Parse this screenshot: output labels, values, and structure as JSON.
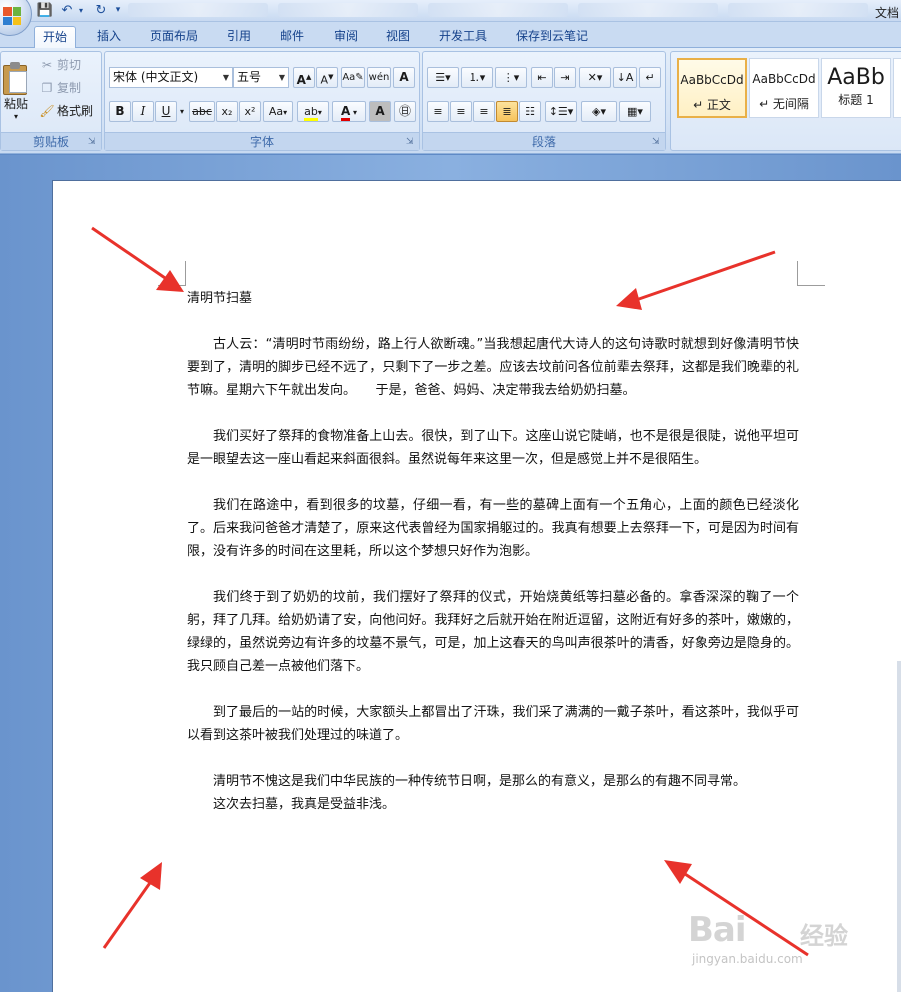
{
  "window": {
    "doc_title": "文档"
  },
  "ribbon_tabs": [
    "开始",
    "插入",
    "页面布局",
    "引用",
    "邮件",
    "审阅",
    "视图",
    "开发工具",
    "保存到云笔记"
  ],
  "clipboard": {
    "paste": "粘贴",
    "cut": "剪切",
    "copy": "复制",
    "format_painter": "格式刷",
    "group_label": "剪贴板"
  },
  "font": {
    "font_name": "宋体 (中文正文)",
    "font_size": "五号",
    "grow_label": "A",
    "shrink_label": "A",
    "case_label": "Aa",
    "clear_label": "A",
    "bold": "B",
    "italic": "I",
    "underline": "U",
    "strike": "abc",
    "subscript": "x₂",
    "superscript": "x²",
    "highlight_label": "ab",
    "color_label": "A",
    "char_shade_label": "A",
    "group_label": "字体"
  },
  "paragraph": {
    "group_label": "段落"
  },
  "styles": [
    {
      "sample": "AaBbCcDd",
      "name": "↵ 正文"
    },
    {
      "sample": "AaBbCcDd",
      "name": "↵ 无间隔"
    },
    {
      "sample": "AaBb",
      "name": "标题 1"
    }
  ],
  "document": {
    "title": "清明节扫墓",
    "paragraphs": [
      "古人云：“清明时节雨纷纷，路上行人欲断魂。”当我想起唐代大诗人的这句诗歌时就想到好像清明节快要到了，清明的脚步已经不远了，只剩下了一步之差。应该去坟前问各位前辈去祭拜，这都是我们晚辈的礼节嘛。星期六下午就出发向。　　于是，爸爸、妈妈、决定带我去给奶奶扫墓。",
      "我们买好了祭拜的食物准备上山去。很快，到了山下。这座山说它陡峭，也不是很是很陡，说他平坦可是一眼望去这一座山看起来斜面很斜。虽然说每年来这里一次，但是感觉上并不是很陌生。",
      "我们在路途中，看到很多的坟墓，仔细一看，有一些的墓碑上面有一个五角心，上面的颜色已经淡化了。后来我问爸爸才清楚了，原来这代表曾经为国家捐躯过的。我真有想要上去祭拜一下，可是因为时间有限，没有许多的时间在这里耗，所以这个梦想只好作为泡影。",
      "我们终于到了奶奶的坟前，我们摆好了祭拜的仪式，开始烧黄纸等扫墓必备的。拿香深深的鞠了一个躬，拜了几拜。给奶奶请了安，向他问好。我拜好之后就开始在附近逗留，这附近有好多的茶叶，嫩嫩的，绿绿的，虽然说旁边有许多的坟墓不景气，可是，加上这春天的鸟叫声很茶叶的清香，好象旁边是隐身的。我只顾自己差一点被他们落下。",
      "到了最后的一站的时候，大家额头上都冒出了汗珠，我们采了满满的一戴子茶叶，看这茶叶，我似乎可以看到这茶叶被我们处理过的味道了。",
      "清明节不愧这是我们中华民族的一种传统节日啊，是那么的有意义，是那么的有趣不同寻常。",
      "这次去扫墓，我真是受益非浅。"
    ]
  },
  "watermark": {
    "logo": "Bai",
    "logo_cn": "经验",
    "url": "jingyan.baidu.com"
  },
  "colors": {
    "annotation_arrow": "#e8322b",
    "ribbon": "#d3e2f5",
    "page": "#ffffff"
  }
}
